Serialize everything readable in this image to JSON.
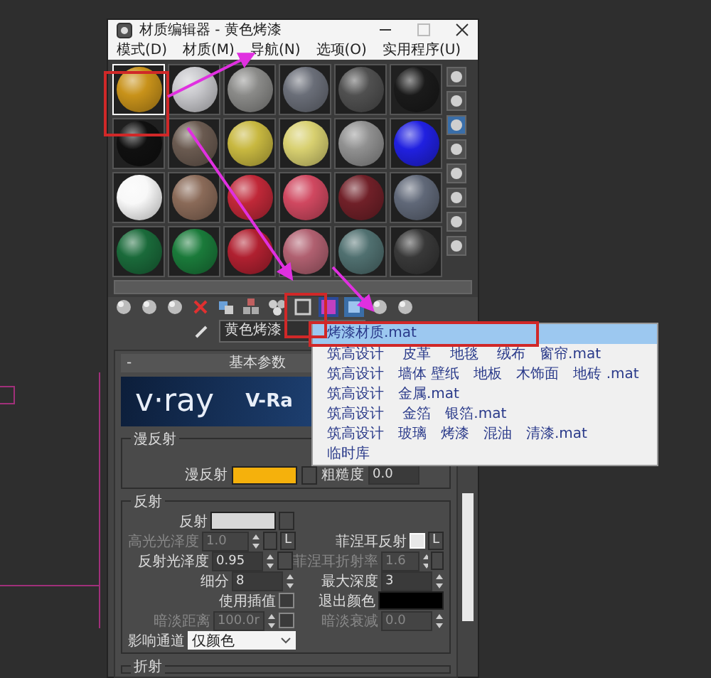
{
  "window": {
    "title": "材质编辑器 - 黄色烤漆"
  },
  "menu": [
    "模式(D)",
    "材质(M)",
    "导航(N)",
    "选项(O)",
    "实用程序(U)"
  ],
  "samples": [
    {
      "color": "#c8921a",
      "selected": true
    },
    {
      "color": "#c8c8cc",
      "selected": false
    },
    {
      "color": "#8a8a88",
      "selected": false
    },
    {
      "color": "#6a6e78",
      "selected": false
    },
    {
      "color": "#505050",
      "selected": false
    },
    {
      "color": "#1a1a1a",
      "selected": false
    },
    {
      "color": "#101010",
      "selected": false
    },
    {
      "color": "#6a5a50",
      "selected": false
    },
    {
      "color": "#c8b840",
      "selected": false
    },
    {
      "color": "#d8d070",
      "selected": false
    },
    {
      "color": "#909090",
      "selected": false
    },
    {
      "color": "#2020e0",
      "selected": false
    },
    {
      "color": "#f8f8f8",
      "selected": false
    },
    {
      "color": "#8a6a58",
      "selected": false
    },
    {
      "color": "#c02838",
      "selected": false
    },
    {
      "color": "#d04860",
      "selected": false
    },
    {
      "color": "#702028",
      "selected": false
    },
    {
      "color": "#606878",
      "selected": false
    },
    {
      "color": "#1a6a3a",
      "selected": false
    },
    {
      "color": "#1a7a3a",
      "selected": false
    },
    {
      "color": "#b02030",
      "selected": false
    },
    {
      "color": "#b06070",
      "selected": false
    },
    {
      "color": "#507070",
      "selected": false
    },
    {
      "color": "#383838",
      "selected": false
    }
  ],
  "material_name": "黄色烤漆",
  "rollout": {
    "toggle": "-",
    "title": "基本参数"
  },
  "banner": {
    "logo": "v·ray",
    "title": "V-Ra"
  },
  "diffuse": {
    "group": "漫反射",
    "label": "漫反射",
    "color": "#f5b10c",
    "roughness_label": "粗糙度",
    "roughness": "0.0"
  },
  "reflection": {
    "group": "反射",
    "rows": [
      {
        "left": {
          "kind": "color",
          "label": "反射",
          "color": "#d8d8d8",
          "map_button": true
        }
      },
      {
        "left": {
          "kind": "spinner",
          "label": "高光光泽度",
          "value": "1.0",
          "disabled": true,
          "map_button": true,
          "lock": "L"
        },
        "right": {
          "kind": "check",
          "label": "菲涅耳反射",
          "checked": true,
          "lock": "L"
        }
      },
      {
        "left": {
          "kind": "spinner",
          "label": "反射光泽度",
          "value": "0.95",
          "disabled": false,
          "map_button": true
        },
        "right": {
          "kind": "spinner",
          "label": "菲涅耳折射率",
          "value": "1.6",
          "disabled": true,
          "map_button": true
        }
      },
      {
        "left": {
          "kind": "spinner",
          "label": "细分",
          "value": "8",
          "disabled": false
        },
        "right": {
          "kind": "spinner",
          "label": "最大深度",
          "value": "3",
          "disabled": false
        }
      },
      {
        "left": {
          "kind": "check",
          "label": "使用插值",
          "checked": false
        },
        "right": {
          "kind": "color",
          "label": "退出颜色",
          "color": "#000000"
        }
      },
      {
        "left": {
          "kind": "spinner",
          "label": "暗淡距离",
          "value": "100.0r",
          "disabled": true,
          "checked": false
        },
        "right": {
          "kind": "spinner",
          "label": "暗淡衰减",
          "value": "0.0",
          "disabled": true
        }
      },
      {
        "left": {
          "kind": "dropdown",
          "label": "影响通道",
          "value": "仅颜色"
        }
      }
    ]
  },
  "refraction": {
    "group": "折射"
  },
  "library_menu": {
    "items": [
      {
        "label": "烤漆材质.mat",
        "selected": true
      },
      {
        "label": "筑高设计　 皮革　 地毯　 绒布　窗帘.mat",
        "selected": false
      },
      {
        "label": "筑高设计　墙体 壁纸　地板　木饰面　地砖 .mat",
        "selected": false
      },
      {
        "label": "筑高设计　金属.mat",
        "selected": false
      },
      {
        "label": "筑高设计　 金箔　银箔.mat",
        "selected": false
      },
      {
        "label": "筑高设计　玻璃　烤漆　混油　清漆.mat",
        "selected": false
      },
      {
        "label": "临时库",
        "selected": false
      }
    ]
  }
}
